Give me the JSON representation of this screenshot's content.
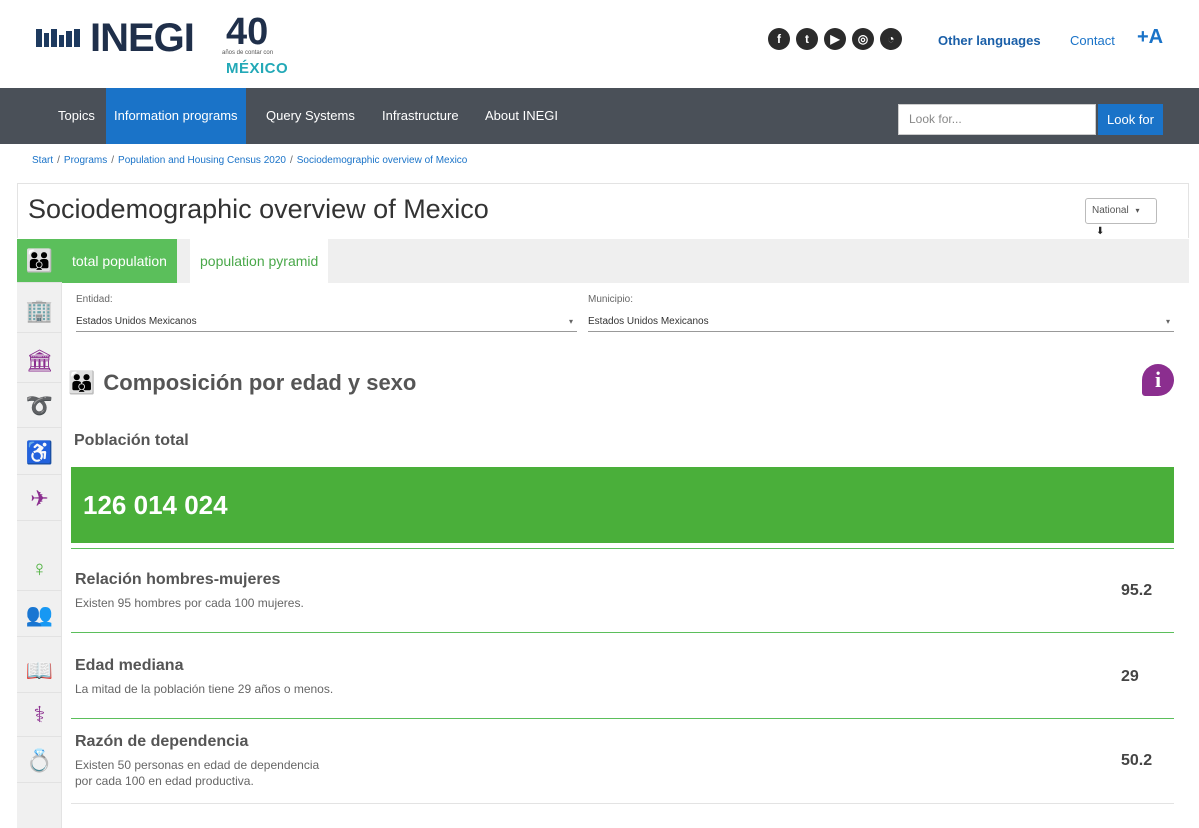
{
  "header": {
    "logo_text": "INEGI",
    "anniversary_number": "40",
    "anniversary_sub": "años de contar con",
    "anniversary_country": "MÉXICO",
    "social_icons": [
      "facebook-icon",
      "twitter-icon",
      "youtube-icon",
      "instagram-icon",
      "rss-icon"
    ],
    "other_languages": "Other languages",
    "contact": "Contact",
    "font_size_toggle": "+A"
  },
  "nav": {
    "items": [
      {
        "label": "Topics"
      },
      {
        "label": "Information programs"
      },
      {
        "label": "Query Systems"
      },
      {
        "label": "Infrastructure"
      },
      {
        "label": "About INEGI"
      }
    ],
    "active_index": 1,
    "search_placeholder": "Look for...",
    "search_button": "Look for"
  },
  "breadcrumb": [
    "Start",
    "Programs",
    "Population and Housing Census 2020",
    "Sociodemographic overview of Mexico"
  ],
  "page": {
    "title": "Sociodemographic overview of Mexico",
    "scope_select": "National"
  },
  "tabs": [
    {
      "label": "total population"
    },
    {
      "label": "population pyramid"
    }
  ],
  "filters": {
    "entidad_label": "Entidad:",
    "entidad_value": "Estados Unidos Mexicanos",
    "municipio_label": "Municipio:",
    "municipio_value": "Estados Unidos Mexicanos"
  },
  "section": {
    "title": "Composición por edad y sexo",
    "info": "i",
    "population_label": "Población total",
    "population_value": "126 014 024"
  },
  "stats": [
    {
      "title": "Relación hombres-mujeres",
      "desc": "Existen 95 hombres por cada 100 mujeres.",
      "value": "95.2"
    },
    {
      "title": "Edad mediana",
      "desc": "La mitad de la población tiene 29 años o menos.",
      "value": "29"
    },
    {
      "title": "Razón de dependencia",
      "desc1": "Existen 50 personas en edad de dependencia",
      "desc2": "por cada 100 en edad productiva.",
      "value": "50.2"
    }
  ],
  "colors": {
    "accent_green": "#4aaf3a",
    "nav_bg": "#4a5058",
    "nav_active": "#1a73c8",
    "info_purple": "#8b2e8f"
  }
}
